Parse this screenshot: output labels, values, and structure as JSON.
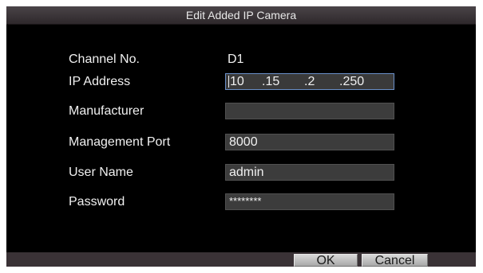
{
  "dialog": {
    "title": "Edit Added IP Camera"
  },
  "fields": {
    "channel": {
      "label": "Channel No.",
      "value": "D1"
    },
    "ip": {
      "label": "IP Address",
      "seg1": "10",
      "seg2": ".15",
      "seg3": ".2",
      "seg4": ".250"
    },
    "manufacturer": {
      "label": "Manufacturer",
      "value": ""
    },
    "port": {
      "label": "Management Port",
      "value": "8000"
    },
    "username": {
      "label": "User Name",
      "value": "admin"
    },
    "password": {
      "label": "Password",
      "value": "********"
    }
  },
  "buttons": {
    "ok": "OK",
    "cancel": "Cancel"
  },
  "colors": {
    "background": "#000000",
    "titlebar": "#3a3438",
    "field": "#3c3c3c",
    "focus_border": "#6a8fc8",
    "bottombar": "#3a3236"
  }
}
